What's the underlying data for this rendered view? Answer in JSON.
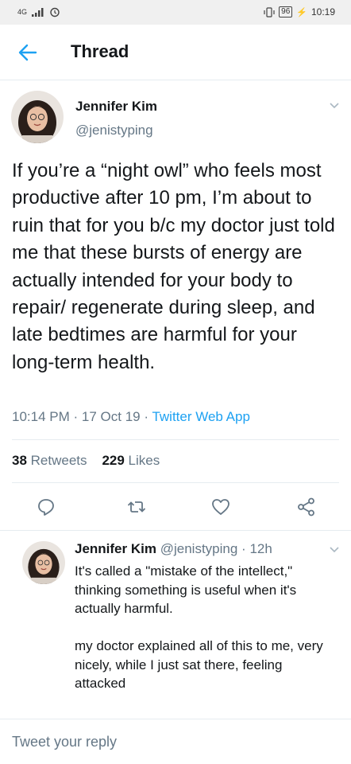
{
  "status_bar": {
    "network": "4G",
    "battery": "96",
    "time": "10:19"
  },
  "header": {
    "title": "Thread"
  },
  "main_tweet": {
    "name": "Jennifer Kim",
    "handle": "@jenistyping",
    "text": "If you’re a “night owl” who feels most productive after 10 pm, I’m about to ruin that for you b/c my doctor just told me that these bursts of energy are actually intended for your body to repair/ regenerate during sleep, and late bedtimes are harmful for your long-term health.",
    "time": "10:14 PM",
    "date": "17 Oct 19",
    "separator": "·",
    "app": "Twitter Web App",
    "retweet_count": "38",
    "retweet_label": "Retweets",
    "like_count": "229",
    "like_label": "Likes"
  },
  "reply": {
    "name": "Jennifer Kim",
    "handle": "@jenistyping",
    "separator": "·",
    "age": "12h",
    "paragraph1": "It's called a \"mistake of the intellect,\" thinking something is useful when it's actually harmful.",
    "paragraph2": "my doctor explained all of this to me, very nicely, while I just sat there, feeling attacked"
  },
  "compose": {
    "placeholder": "Tweet your reply"
  },
  "colors": {
    "accent": "#1da1f2",
    "secondary_text": "#657786",
    "divider": "#e6ecf0"
  }
}
